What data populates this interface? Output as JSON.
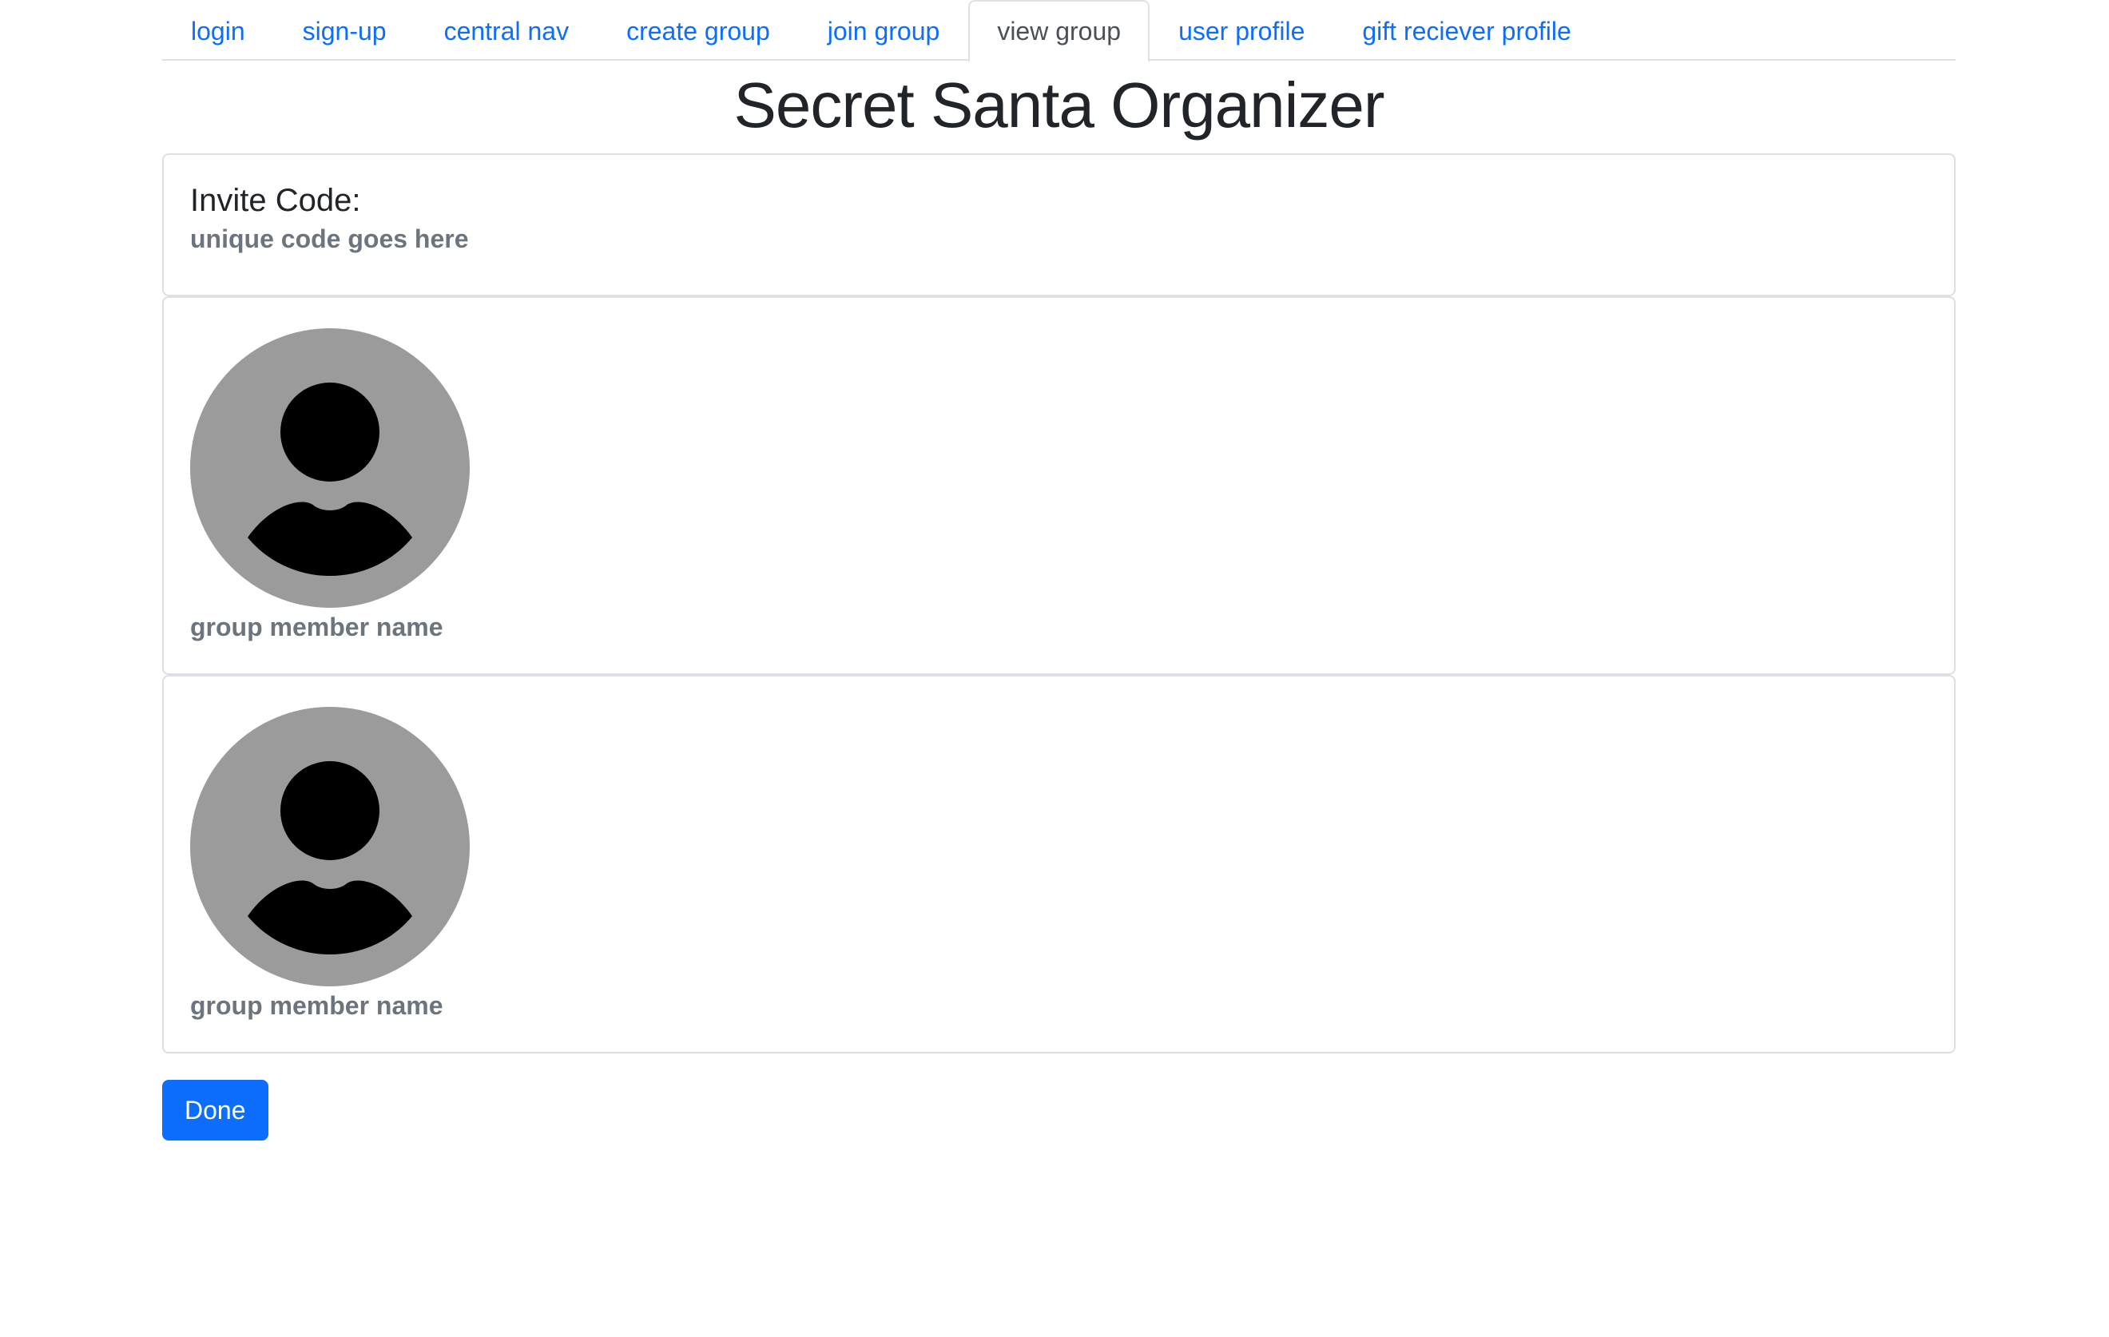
{
  "nav": {
    "tabs": [
      {
        "label": "login",
        "active": false
      },
      {
        "label": "sign-up",
        "active": false
      },
      {
        "label": "central nav",
        "active": false
      },
      {
        "label": "create group",
        "active": false
      },
      {
        "label": "join group",
        "active": false
      },
      {
        "label": "view group",
        "active": true
      },
      {
        "label": "user profile",
        "active": false
      },
      {
        "label": "gift reciever profile",
        "active": false
      }
    ]
  },
  "page": {
    "title": "Secret Santa Organizer"
  },
  "invite": {
    "heading": "Invite Code:",
    "code": "unique code goes here"
  },
  "members": [
    {
      "name": "group member name",
      "avatar_icon": "user-avatar-icon"
    },
    {
      "name": "group member name",
      "avatar_icon": "user-avatar-icon"
    }
  ],
  "actions": {
    "done_label": "Done"
  },
  "colors": {
    "accent": "#0d6efd",
    "avatar_bg": "#9b9b9b",
    "avatar_fg": "#000000",
    "muted_text": "#6c757d"
  }
}
